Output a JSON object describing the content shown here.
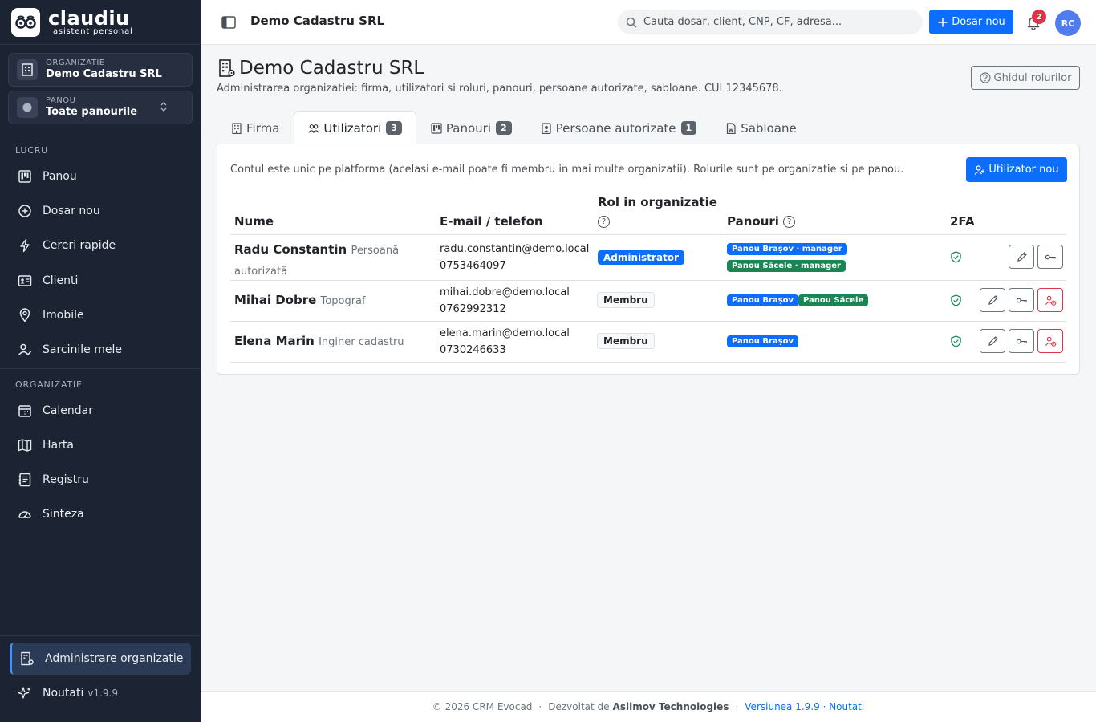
{
  "brand": {
    "name": "claudiu",
    "tagline": "asistent personal"
  },
  "org_selector": {
    "label": "ORGANIZATIE",
    "value": "Demo Cadastru SRL"
  },
  "panel_selector": {
    "label": "PANOU",
    "value": "Toate panourile"
  },
  "sidebar": {
    "section_work": "LUCRU",
    "section_org": "ORGANIZATIE",
    "work_items": [
      "Panou",
      "Dosar nou",
      "Cereri rapide",
      "Clienti",
      "Imobile",
      "Sarcinile mele"
    ],
    "org_items": [
      "Calendar",
      "Harta",
      "Registru",
      "Sinteza"
    ],
    "admin": "Administrare organizatie",
    "news": "Noutati",
    "version": "v1.9.9"
  },
  "topbar": {
    "title": "Demo Cadastru SRL",
    "search_placeholder": "Cauta dosar, client, CNP, CF, adresa...",
    "new_case_label": "Dosar nou",
    "notifications": "2",
    "avatar": "RC"
  },
  "page": {
    "title": "Demo Cadastru SRL",
    "subtitle": "Administrarea organizatiei: firma, utilizatori si roluri, panouri, persoane autorizate, sabloane. CUI 12345678.",
    "guide_button": "Ghidul rolurilor"
  },
  "tabs": [
    {
      "label": "Firma",
      "count": null
    },
    {
      "label": "Utilizatori",
      "count": "3"
    },
    {
      "label": "Panouri",
      "count": "2"
    },
    {
      "label": "Persoane autorizate",
      "count": "1"
    },
    {
      "label": "Sabloane",
      "count": null
    }
  ],
  "users_card": {
    "info": "Contul este unic pe platforma (acelasi e-mail poate fi membru in mai multe organizatii). Rolurile sunt pe organizatie si pe panou.",
    "new_user_button": "Utilizator nou",
    "columns": {
      "name": "Nume",
      "contact": "E-mail / telefon",
      "role": "Rol in organizatie",
      "panels": "Panouri",
      "twofa": "2FA"
    },
    "help_mark": "?",
    "rows": [
      {
        "name": "Radu Constantin",
        "title": "Persoană autorizată",
        "email": "radu.constantin@demo.local",
        "phone": "0753464097",
        "role": "Administrator",
        "panels": [
          "Panou Brașov · manager",
          "Panou Săcele · manager"
        ]
      },
      {
        "name": "Mihai Dobre",
        "title": "Topograf",
        "email": "mihai.dobre@demo.local",
        "phone": "0762992312",
        "role": "Membru",
        "panels": [
          "Panou Brașov",
          "Panou Săcele"
        ]
      },
      {
        "name": "Elena Marin",
        "title": "Inginer cadastru",
        "email": "elena.marin@demo.local",
        "phone": "0730246633",
        "role": "Membru",
        "panels": [
          "Panou Brașov"
        ]
      }
    ]
  },
  "footer": {
    "copyright": "© 2026 CRM Evocad",
    "dev_prefix": "Dezvoltat de",
    "dev_name": "Asiimov Technologies",
    "version_link": "Versiunea 1.9.9 · Noutati",
    "separator": "·"
  },
  "colors": {
    "sidebar_bg": "#1c2333",
    "primary": "#0d6efd",
    "success": "#198754",
    "danger": "#dc3545"
  }
}
